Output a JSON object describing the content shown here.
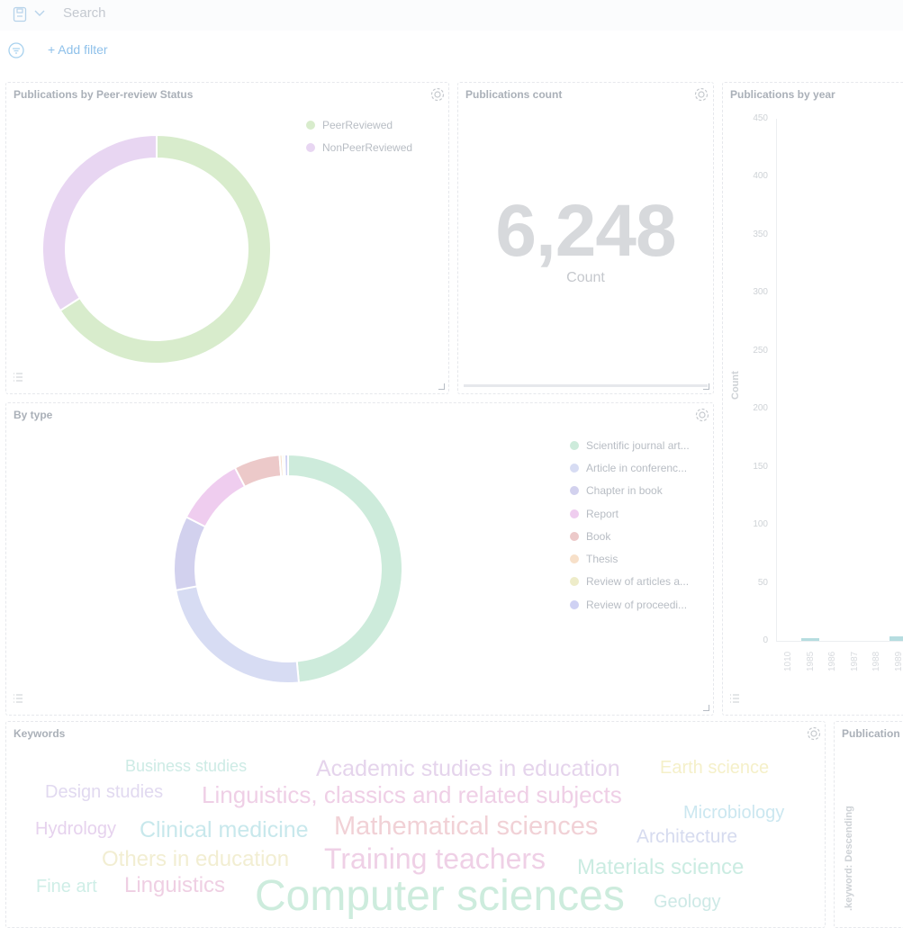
{
  "query_bar": {
    "search_placeholder": "Search"
  },
  "filter_bar": {
    "add_filter_label": "+ Add filter"
  },
  "panels": {
    "peer_review": {
      "title": "Publications by Peer-review Status",
      "legend": [
        {
          "label": "PeerReviewed",
          "color": "#d8eccc"
        },
        {
          "label": "NonPeerReviewed",
          "color": "#e8d6f2"
        }
      ]
    },
    "count": {
      "title": "Publications count",
      "value": "6,248",
      "label": "Count"
    },
    "by_year": {
      "title": "Publications by year",
      "y_axis_label": "Count",
      "y_ticks": [
        "450",
        "400",
        "350",
        "300",
        "250",
        "200",
        "150",
        "100",
        "50",
        "0"
      ],
      "x_ticks": [
        "1010",
        "1985",
        "1986",
        "1987",
        "1988",
        "1989"
      ]
    },
    "by_type": {
      "title": "By type",
      "legend": [
        {
          "label": "Scientific journal art...",
          "color": "#cdebdb"
        },
        {
          "label": "Article in conferenc...",
          "color": "#d7dcf3"
        },
        {
          "label": "Chapter in book",
          "color": "#d2d1ee"
        },
        {
          "label": "Report",
          "color": "#efcdef"
        },
        {
          "label": "Book",
          "color": "#ecc9c9"
        },
        {
          "label": "Thesis",
          "color": "#f7e0c9"
        },
        {
          "label": "Review of articles a...",
          "color": "#eeecc9"
        },
        {
          "label": "Review of proceedi...",
          "color": "#cfd1f3"
        }
      ]
    },
    "keywords": {
      "title": "Keywords",
      "words": [
        {
          "text": "Business studies",
          "color": "#cdebe5"
        },
        {
          "text": "Academic studies in education",
          "color": "#e5d4ec"
        },
        {
          "text": "Earth science",
          "color": "#f5f0c9"
        },
        {
          "text": "Design studies",
          "color": "#e1d9f0"
        },
        {
          "text": "Linguistics, classics and related subjects",
          "color": "#efcfe6"
        },
        {
          "text": "Microbiology",
          "color": "#cbe7f0"
        },
        {
          "text": "Hydrology",
          "color": "#e6d2ee"
        },
        {
          "text": "Clinical medicine",
          "color": "#c8e8ec"
        },
        {
          "text": "Mathematical sciences",
          "color": "#f1d1d6"
        },
        {
          "text": "Architecture",
          "color": "#d6dbef"
        },
        {
          "text": "Others in education",
          "color": "#f2eed2"
        },
        {
          "text": "Training teachers",
          "color": "#efd0e6"
        },
        {
          "text": "Materials science",
          "color": "#cbece2"
        },
        {
          "text": "Fine art",
          "color": "#cfeee7"
        },
        {
          "text": "Linguistics",
          "color": "#efcfe3"
        },
        {
          "text": "Computer sciences",
          "color": "#cdecdd"
        },
        {
          "text": "Geology",
          "color": "#cde9e6"
        }
      ]
    },
    "publications_side": {
      "title": "Publication",
      "axis_label": ".keyword: Descending"
    }
  },
  "chart_data": [
    {
      "type": "pie",
      "labels": [
        "PeerReviewed",
        "NonPeerReviewed"
      ],
      "values": [
        66,
        34
      ],
      "legend": "top-right"
    },
    {
      "type": "pie",
      "labels": [
        "Scientific journal art...",
        "Article in conferenc...",
        "Chapter in book",
        "Report",
        "Book",
        "Thesis",
        "Review of articles a...",
        "Review of proceedi..."
      ],
      "values": [
        48.5,
        23.5,
        10.5,
        9.8,
        6.5,
        0.4,
        0.3,
        0.5
      ],
      "legend": "top-right"
    },
    {
      "type": "bar",
      "categories": [
        "1010",
        "1985",
        "1986",
        "1987",
        "1988",
        "1989"
      ],
      "values": [
        0,
        2,
        0,
        0,
        0,
        4
      ],
      "ylabel": "Count",
      "ylim": [
        0,
        450
      ]
    }
  ]
}
